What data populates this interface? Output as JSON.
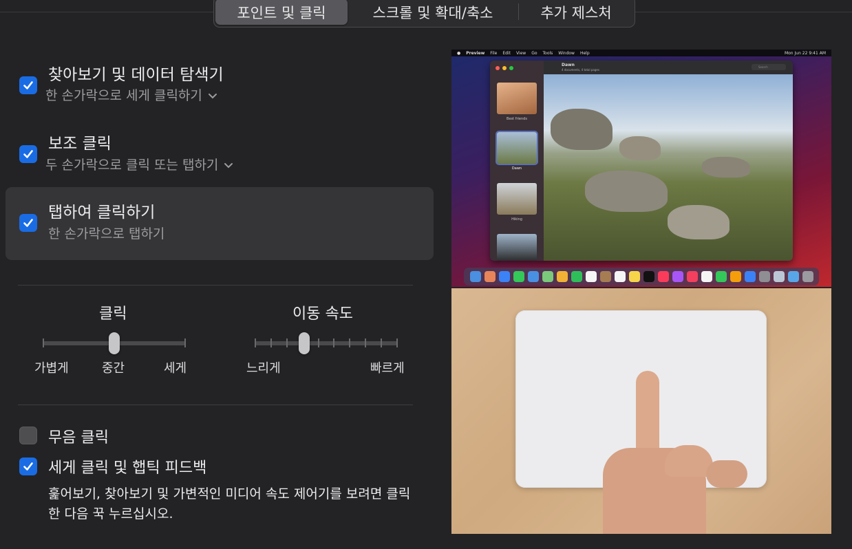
{
  "tabs": [
    {
      "label": "포인트 및 클릭",
      "active": true
    },
    {
      "label": "스크롤 및 확대/축소",
      "active": false
    },
    {
      "label": "추가 제스처",
      "active": false
    }
  ],
  "options": {
    "lookup": {
      "title": "찾아보기 및 데이터 탐색기",
      "subtitle": "한 손가락으로 세게 클릭하기",
      "checked": true
    },
    "secondary_click": {
      "title": "보조 클릭",
      "subtitle": "두 손가락으로 클릭 또는 탭하기",
      "checked": true
    },
    "tap_to_click": {
      "title": "탭하여 클릭하기",
      "subtitle": "한 손가락으로 탭하기",
      "checked": true
    }
  },
  "click_slider": {
    "title": "클릭",
    "labels": [
      "가볍게",
      "중간",
      "세게"
    ],
    "value": "중간"
  },
  "tracking_slider": {
    "title": "이동 속도",
    "min_label": "느리게",
    "max_label": "빠르게",
    "value_fraction": 0.35
  },
  "silent_click": {
    "label": "무음 클릭",
    "checked": false
  },
  "force_click": {
    "label": "세게 클릭 및 햅틱 피드백",
    "checked": true,
    "description": "훑어보기, 찾아보기 및 가변적인 미디어 속도 제어기를 보려면 클릭한 다음 꾹 누르십시오."
  },
  "preview": {
    "menubar": {
      "items": [
        "Preview",
        "File",
        "Edit",
        "View",
        "Go",
        "Tools",
        "Window",
        "Help"
      ],
      "clock": "Mon Jun 22  9:41 AM"
    },
    "window_title": "Dawn",
    "window_subtitle": "4 documents, 4 total pages",
    "search_placeholder": "Search",
    "thumb_captions": [
      "Best friends",
      "Dawn",
      "Hiking"
    ],
    "accent": "#1a6ce5"
  }
}
